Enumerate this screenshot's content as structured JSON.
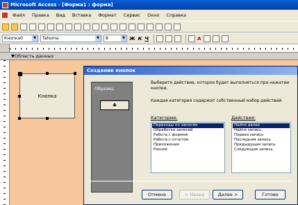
{
  "window": {
    "title": "Microsoft Access - [Форма1 : форма]"
  },
  "menu": [
    "Файл",
    "Правка",
    "Вид",
    "Вставка",
    "Формат",
    "Сервис",
    "Окно",
    "Справка"
  ],
  "format_toolbar": {
    "object": "Кнопка0",
    "font": "Tahoma",
    "size": "8"
  },
  "section": {
    "label": "Область данных"
  },
  "form_button": {
    "label": "Кнопка"
  },
  "wizard": {
    "title": "Создание кнопок",
    "preview_label": "Образец:",
    "preview_icon": "♣",
    "instruction": "Выберите действие, которое будет выполняться при нажатии кнопки.",
    "instruction2": "Каждая категория содержит собственный набор действий.",
    "categories_label": "Категории:",
    "actions_label": "Действия:",
    "categories": [
      "Переходы по записям",
      "Обработка записей",
      "Работа с формой",
      "Работа с отчетом",
      "Приложение",
      "Разное"
    ],
    "actions": [
      "Найти далее",
      "Найти запись",
      "Первая запись",
      "Последняя запись",
      "Предыдущая запись",
      "Следующая запись"
    ],
    "selected_category": 0,
    "selected_action": 0,
    "buttons": {
      "cancel": "Отмена",
      "back": "< Назад",
      "next": "Далее >",
      "finish": "Готово"
    }
  }
}
